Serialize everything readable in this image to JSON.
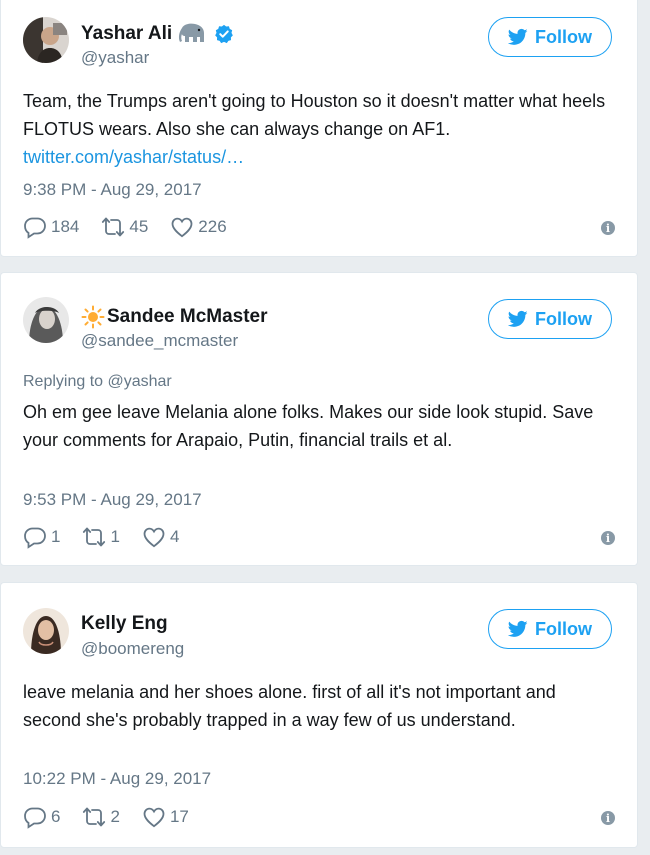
{
  "colors": {
    "accent": "#1da1f2",
    "link": "#1b95e0",
    "secondary_text": "#657786",
    "primary_text": "#14171a",
    "verified": "#1da1f2"
  },
  "follow_label": "Follow",
  "tweets": [
    {
      "name": "Yashar Ali",
      "handle": "@yashar",
      "name_icons": [
        "elephant-icon",
        "verified-icon"
      ],
      "text": "Team, the Trumps aren't going to Houston so it doesn't matter what heels FLOTUS wears. Also she can always change on AF1.",
      "link": "twitter.com/yashar/status/…",
      "timestamp": "9:38 PM - Aug 29, 2017",
      "replies": "184",
      "retweets": "45",
      "likes": "226"
    },
    {
      "name": "Sandee McMaster",
      "handle": "@sandee_mcmaster",
      "name_icons": [
        "sun-icon"
      ],
      "reply_to": "Replying to @yashar",
      "text": "Oh em gee leave Melania alone folks. Makes our side look stupid. Save your comments for Arapaio, Putin, financial trails et al.",
      "timestamp": "9:53 PM - Aug 29, 2017",
      "replies": "1",
      "retweets": "1",
      "likes": "4"
    },
    {
      "name": "Kelly Eng",
      "handle": "@boomereng",
      "text": "leave melania and her shoes alone. first of all it's not important and second she's probably trapped in a way few of us understand.",
      "timestamp": "10:22 PM - Aug 29, 2017",
      "replies": "6",
      "retweets": "2",
      "likes": "17"
    }
  ]
}
